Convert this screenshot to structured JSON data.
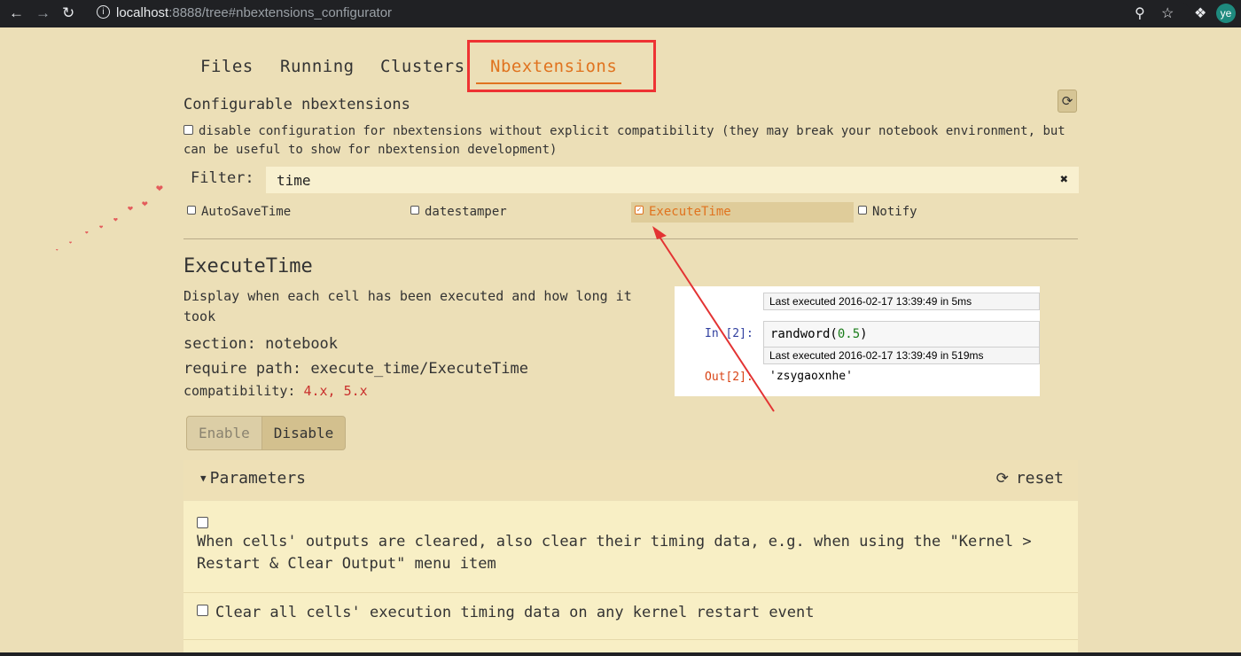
{
  "browser": {
    "url_host": "localhost",
    "url_path": ":8888/tree#nbextensions_configurator",
    "avatar_initials": "ye"
  },
  "tabs": [
    {
      "label": "Files"
    },
    {
      "label": "Running"
    },
    {
      "label": "Clusters"
    },
    {
      "label": "Nbextensions",
      "active": true
    }
  ],
  "page": {
    "title": "Configurable nbextensions",
    "disable_compat_label": "disable configuration for nbextensions without explicit compatibility (they may break your notebook environment, but can be useful to show for nbextension development)"
  },
  "filter": {
    "label": "Filter:",
    "value": "time"
  },
  "extensions": [
    {
      "name": "AutoSaveTime",
      "checked": false
    },
    {
      "name": "datestamper",
      "checked": false
    },
    {
      "name": "ExecuteTime",
      "checked": true,
      "selected": true
    },
    {
      "name": "Notify",
      "checked": false
    }
  ],
  "detail": {
    "name": "ExecuteTime",
    "description": "Display when each cell has been executed and how long it took",
    "section_label": "section:",
    "section_value": "notebook",
    "require_label": "require path:",
    "require_value": "execute_time/ExecuteTime",
    "compat_label": "compatibility:",
    "compat_value": "4.x, 5.x",
    "enable_label": "Enable",
    "disable_label": "Disable"
  },
  "preview": {
    "out1": "Last executed 2016-02-17 13:39:49 in 5ms",
    "in_prompt": "In [2]:",
    "code_fn": "randword(",
    "code_num": "0.5",
    "code_end": ")",
    "out2": "Last executed 2016-02-17 13:39:49 in 519ms",
    "out_prompt": "Out[2]:",
    "result": "'zsygaoxnhe'"
  },
  "parameters": {
    "title": "Parameters",
    "reset_label": "reset",
    "items": [
      {
        "text": "When cells' outputs are cleared, also clear their timing data, e.g. when using the \"Kernel > Restart & Clear Output\" menu item",
        "checked": false
      },
      {
        "text": "Clear all cells' execution timing data on any kernel restart event",
        "checked": false
      }
    ]
  },
  "colors": {
    "background": "#ecdfb7",
    "accent": "#e0731f",
    "annotation": "#e33333"
  }
}
